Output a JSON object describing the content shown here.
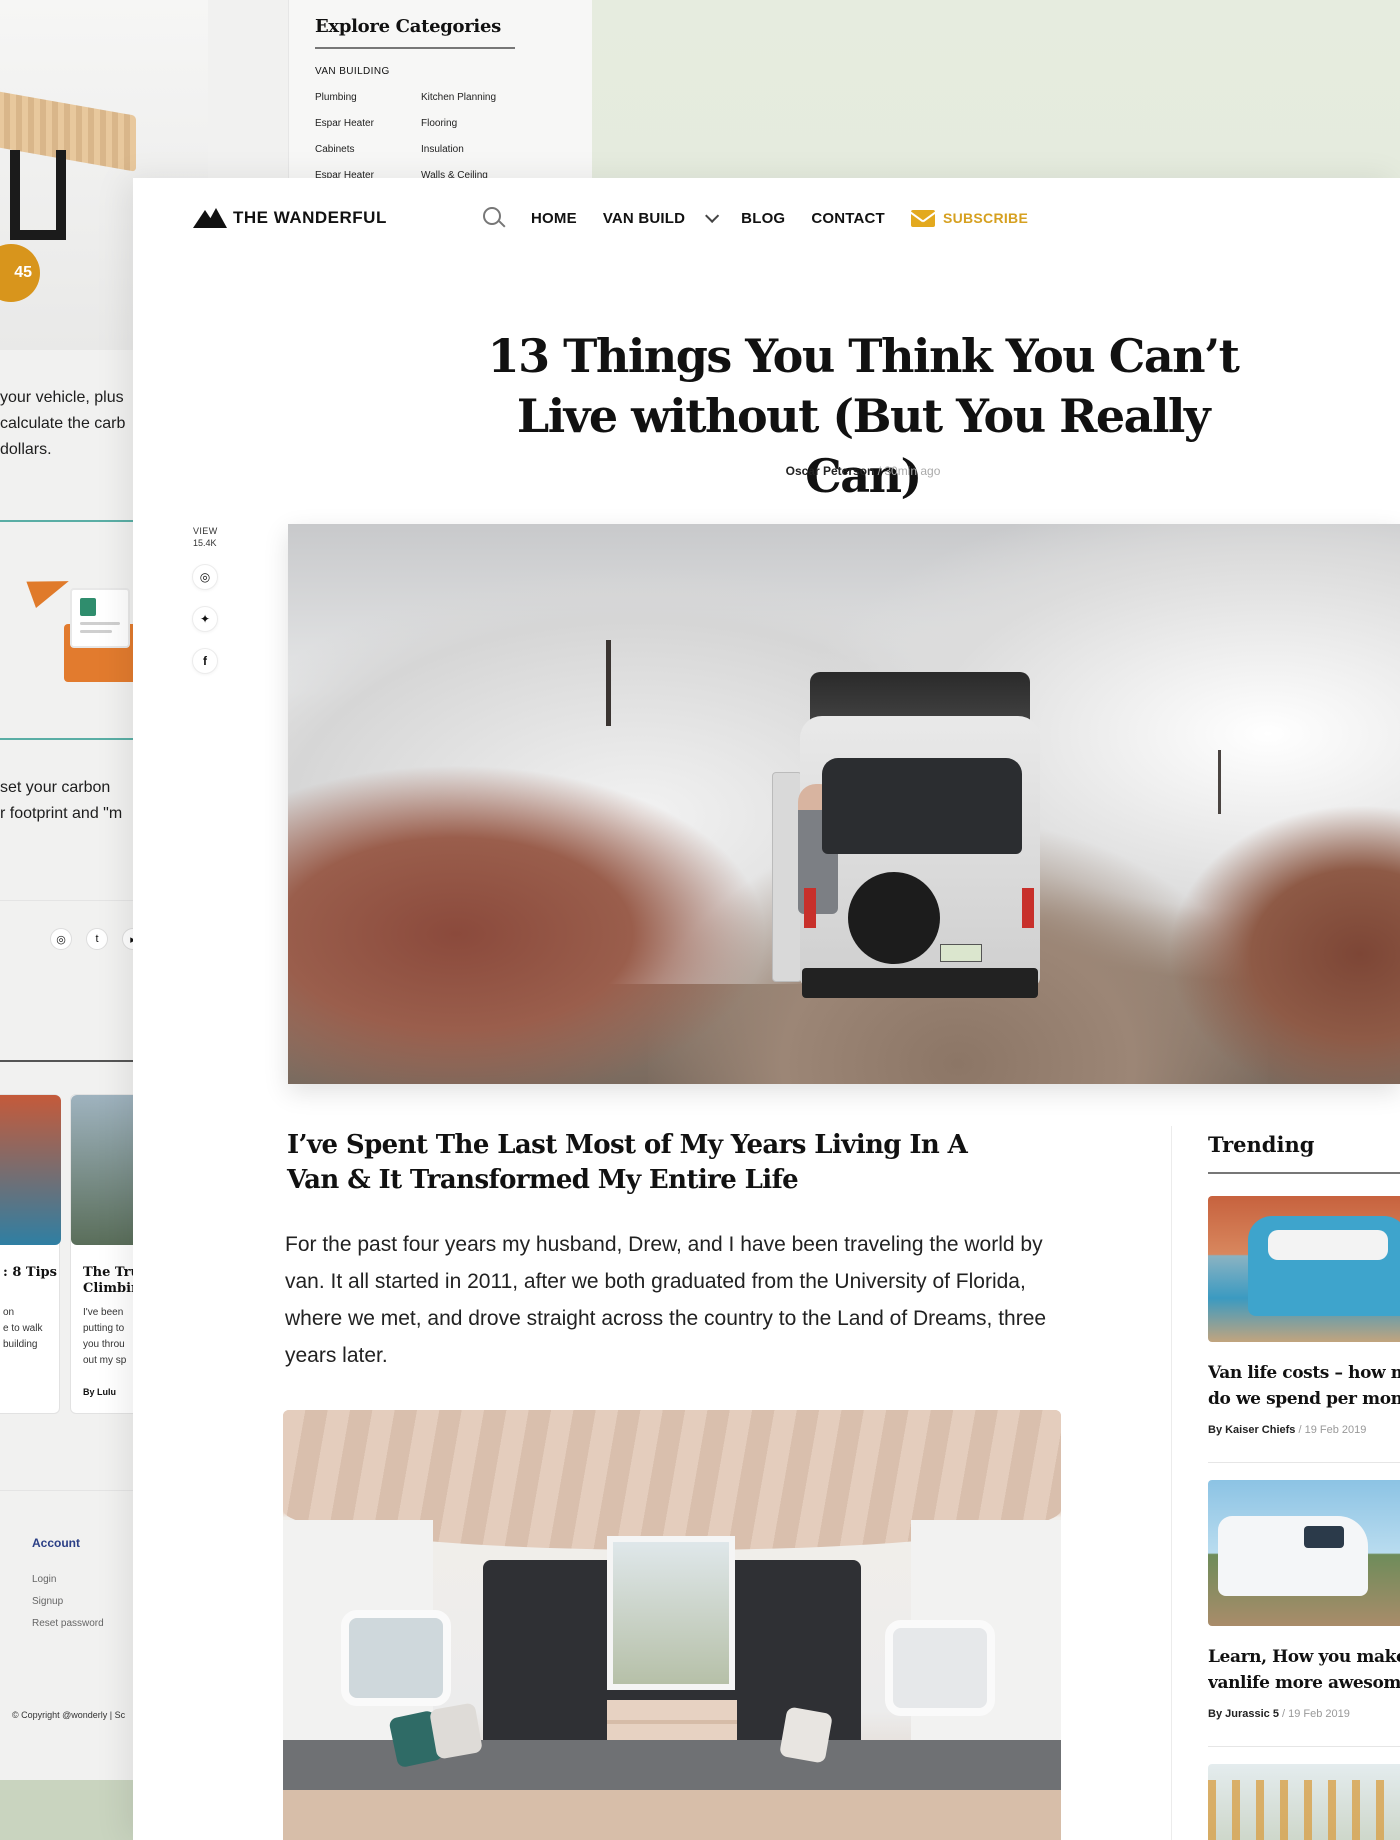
{
  "background_page": {
    "price": "45",
    "text_block_1": [
      "your vehicle, plus",
      "calculate the carb",
      "dollars."
    ],
    "text_block_2": [
      "set your carbon",
      "r footprint and \"m"
    ],
    "social_icons": [
      "instagram-icon",
      "twitter-icon",
      "youtube-icon"
    ],
    "post_1": {
      "title": ": 8 Tips",
      "lines": [
        "on",
        "e to walk",
        "building"
      ]
    },
    "post_2": {
      "title_lines": [
        "The Tru",
        "Climbin"
      ],
      "lines": [
        "I've been",
        "putting to",
        "you throu",
        "out my sp"
      ],
      "by": "By Lulu"
    },
    "footer": {
      "title": "Account",
      "links": [
        "Login",
        "Signup",
        "Reset password"
      ],
      "copyright": "© Copyright @wonderly | Sc"
    },
    "explore": {
      "title": "Explore Categories",
      "section": "VAN BUILDING",
      "items_left": [
        "Plumbing",
        "Espar Heater",
        "Cabinets",
        "Espar Heater"
      ],
      "items_right": [
        "Kitchen Planning",
        "Flooring",
        "Insulation",
        "Walls & Ceiling"
      ]
    }
  },
  "nav": {
    "logo_icon": "mountain-icon",
    "logo_text": "THE WANDERFUL",
    "items": [
      "HOME",
      "VAN BUILD",
      "BLOG",
      "CONTACT"
    ],
    "subscribe": "SUBSCRIBE"
  },
  "article": {
    "title": "13 Things You Think You Can’t Live without (But You Really Can)",
    "author": "Oscar Peterson",
    "time": "/ 30min ago",
    "views_label": "VIEW",
    "views_count": "15.4K",
    "share_icons": [
      "instagram-icon",
      "twitter-icon",
      "facebook-icon"
    ],
    "subheading": "I’ve Spent The Last Most of  My Years Living In A Van & It Transformed My Entire Life",
    "lead": "For the past four years my husband, Drew, and I have been traveling the world by van. It all started in 2011, after we both graduated from the University of Florida, where we met, and drove straight across the country to the Land of Dreams, three years later."
  },
  "sidebar": {
    "title": "Trending",
    "items": [
      {
        "title_1": "Van life costs – how much",
        "title_2": "do we spend per month",
        "author": "By Kaiser Chiefs",
        "date": " / 19 Feb 2019"
      },
      {
        "title_1": "Learn, How you make",
        "title_2": "vanlife more awesome",
        "author": "By Jurassic 5",
        "date": " / 19 Feb 2019"
      },
      {
        "title_1": "",
        "title_2": "",
        "author": "",
        "date": ""
      }
    ]
  },
  "colors": {
    "accent": "#d6a020",
    "price_badge": "#d8951c",
    "text": "#111111"
  }
}
